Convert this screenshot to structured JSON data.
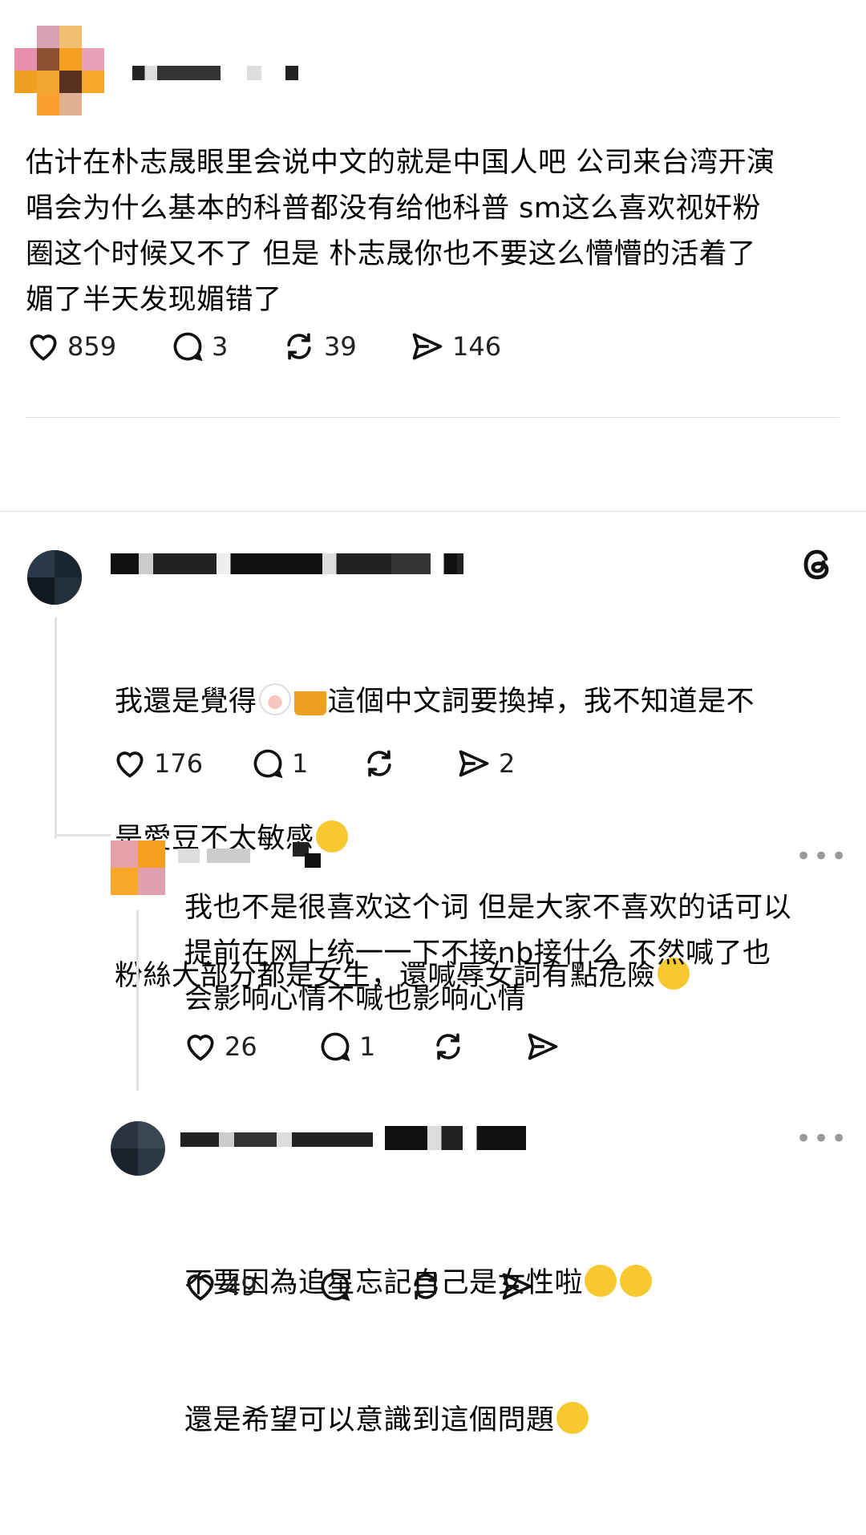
{
  "post": {
    "text": "估计在朴志晟眼里会说中文的就是中国人吧 公司来台湾开演\n唱会为什么基本的科普都没有给他科普 sm这么喜欢视奸粉\n圈这个时候又不了 但是 朴志晟你也不要这么懵懵的活着了\n媚了半天发现媚错了",
    "likes": "859",
    "comments": "3",
    "reposts": "39",
    "shares": "146"
  },
  "replies": [
    {
      "line1": "我還是覺得",
      "line1_after": "這個中文詞要換掉，我不知道是不",
      "line2": "是愛豆不太敏感",
      "line3": "粉絲大部分都是女生，還喊辱女詞有點危險",
      "likes": "176",
      "comments": "1",
      "shares": "2"
    },
    {
      "text": "我也不是很喜欢这个词 但是大家不喜欢的话可以\n提前在网上统一一下不接nb接什么 不然喊了也\n会影响心情不喊也影响心情",
      "likes": "26",
      "comments": "1"
    },
    {
      "line1": "不要因為追星忘記自己是女性啦",
      "line2": "還是希望可以意識到這個問題",
      "likes": "49"
    }
  ],
  "icons": [
    "heart-icon",
    "comment-icon",
    "repost-icon",
    "share-icon",
    "threads-logo-icon",
    "more-icon"
  ],
  "more_label": "•••"
}
